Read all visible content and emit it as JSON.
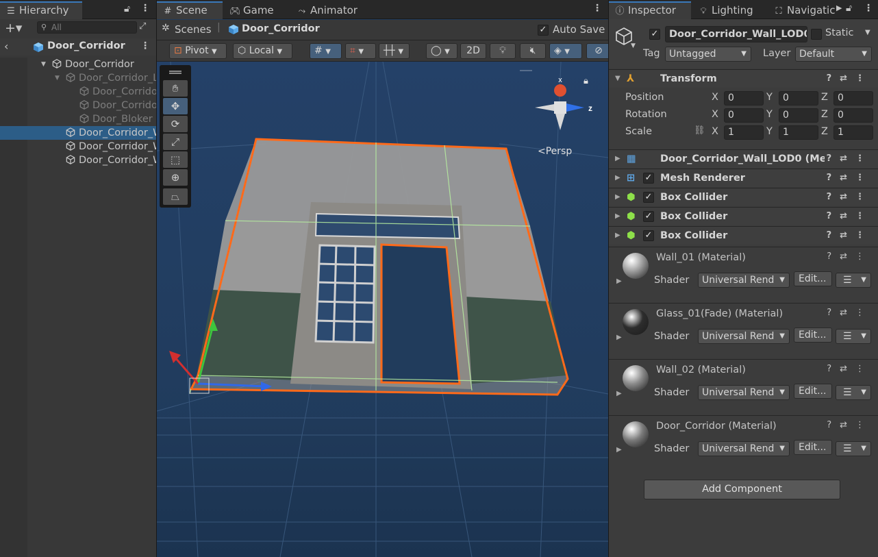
{
  "hierarchy": {
    "tab_label": "Hierarchy",
    "search_placeholder": "All",
    "scene_name": "Door_Corridor",
    "items": [
      {
        "label": "Door_Corridor",
        "indent": 1,
        "dim": false,
        "selected": false,
        "arrow": "▼"
      },
      {
        "label": "Door_Corridor_L",
        "indent": 2,
        "dim": true,
        "selected": false,
        "arrow": "▼"
      },
      {
        "label": "Door_Corrido",
        "indent": 3,
        "dim": true,
        "selected": false,
        "arrow": ""
      },
      {
        "label": "Door_Corrido",
        "indent": 3,
        "dim": true,
        "selected": false,
        "arrow": ""
      },
      {
        "label": "Door_Bloker",
        "indent": 3,
        "dim": true,
        "selected": false,
        "arrow": ""
      },
      {
        "label": "Door_Corridor_W",
        "indent": 2,
        "dim": false,
        "selected": true,
        "arrow": ""
      },
      {
        "label": "Door_Corridor_W",
        "indent": 2,
        "dim": false,
        "selected": false,
        "arrow": ""
      },
      {
        "label": "Door_Corridor_W",
        "indent": 2,
        "dim": false,
        "selected": false,
        "arrow": ""
      }
    ]
  },
  "scene": {
    "tabs": [
      "Scene",
      "Game",
      "Animator"
    ],
    "breadcrumb_root": "Scenes",
    "breadcrumb_current": "Door_Corridor",
    "auto_save_label": "Auto Save",
    "pivot_label": "Pivot",
    "local_label": "Local",
    "mode_2d": "2D",
    "persp_label": "<Persp",
    "gizmo_x": "x",
    "gizmo_z": "z"
  },
  "inspector": {
    "tabs": [
      "Inspector",
      "Lighting",
      "Navigatic"
    ],
    "object_name": "Door_Corridor_Wall_LOD0",
    "static_label": "Static",
    "tag_label": "Tag",
    "tag_value": "Untagged",
    "layer_label": "Layer",
    "layer_value": "Default",
    "transform": {
      "title": "Transform",
      "position_label": "Position",
      "rotation_label": "Rotation",
      "scale_label": "Scale",
      "position": [
        "0",
        "0",
        "0"
      ],
      "rotation": [
        "0",
        "0",
        "0"
      ],
      "scale": [
        "1",
        "1",
        "1"
      ],
      "axis": [
        "X",
        "Y",
        "Z"
      ]
    },
    "components": [
      {
        "title": "Door_Corridor_Wall_LOD0 (Mes",
        "checkbox": false,
        "icon": "grid-icon"
      },
      {
        "title": "Mesh Renderer",
        "checkbox": true,
        "icon": "mesh-renderer-icon"
      },
      {
        "title": "Box Collider",
        "checkbox": true,
        "icon": "box-collider-icon"
      },
      {
        "title": "Box Collider",
        "checkbox": true,
        "icon": "box-collider-icon"
      },
      {
        "title": "Box Collider",
        "checkbox": true,
        "icon": "box-collider-icon"
      }
    ],
    "materials": [
      {
        "name": "Wall_01 (Material)",
        "shader_label": "Shader",
        "shader_value": "Universal Rend",
        "edit_label": "Edit...",
        "color": "#9a9a9a"
      },
      {
        "name": "Glass_01(Fade) (Material)",
        "shader_label": "Shader",
        "shader_value": "Universal Rend",
        "edit_label": "Edit...",
        "color": "#2d2d2d"
      },
      {
        "name": "Wall_02 (Material)",
        "shader_label": "Shader",
        "shader_value": "Universal Rend",
        "edit_label": "Edit...",
        "color": "#8a8a8a"
      },
      {
        "name": "Door_Corridor (Material)",
        "shader_label": "Shader",
        "shader_value": "Universal Rend",
        "edit_label": "Edit...",
        "color": "#7a7a7a"
      }
    ],
    "add_component_label": "Add Component"
  },
  "colors": {
    "selection": "#2c5d87",
    "outline": "#ff6a1a",
    "scene_bg": "#213c5c",
    "accent": "#3a79bb"
  }
}
